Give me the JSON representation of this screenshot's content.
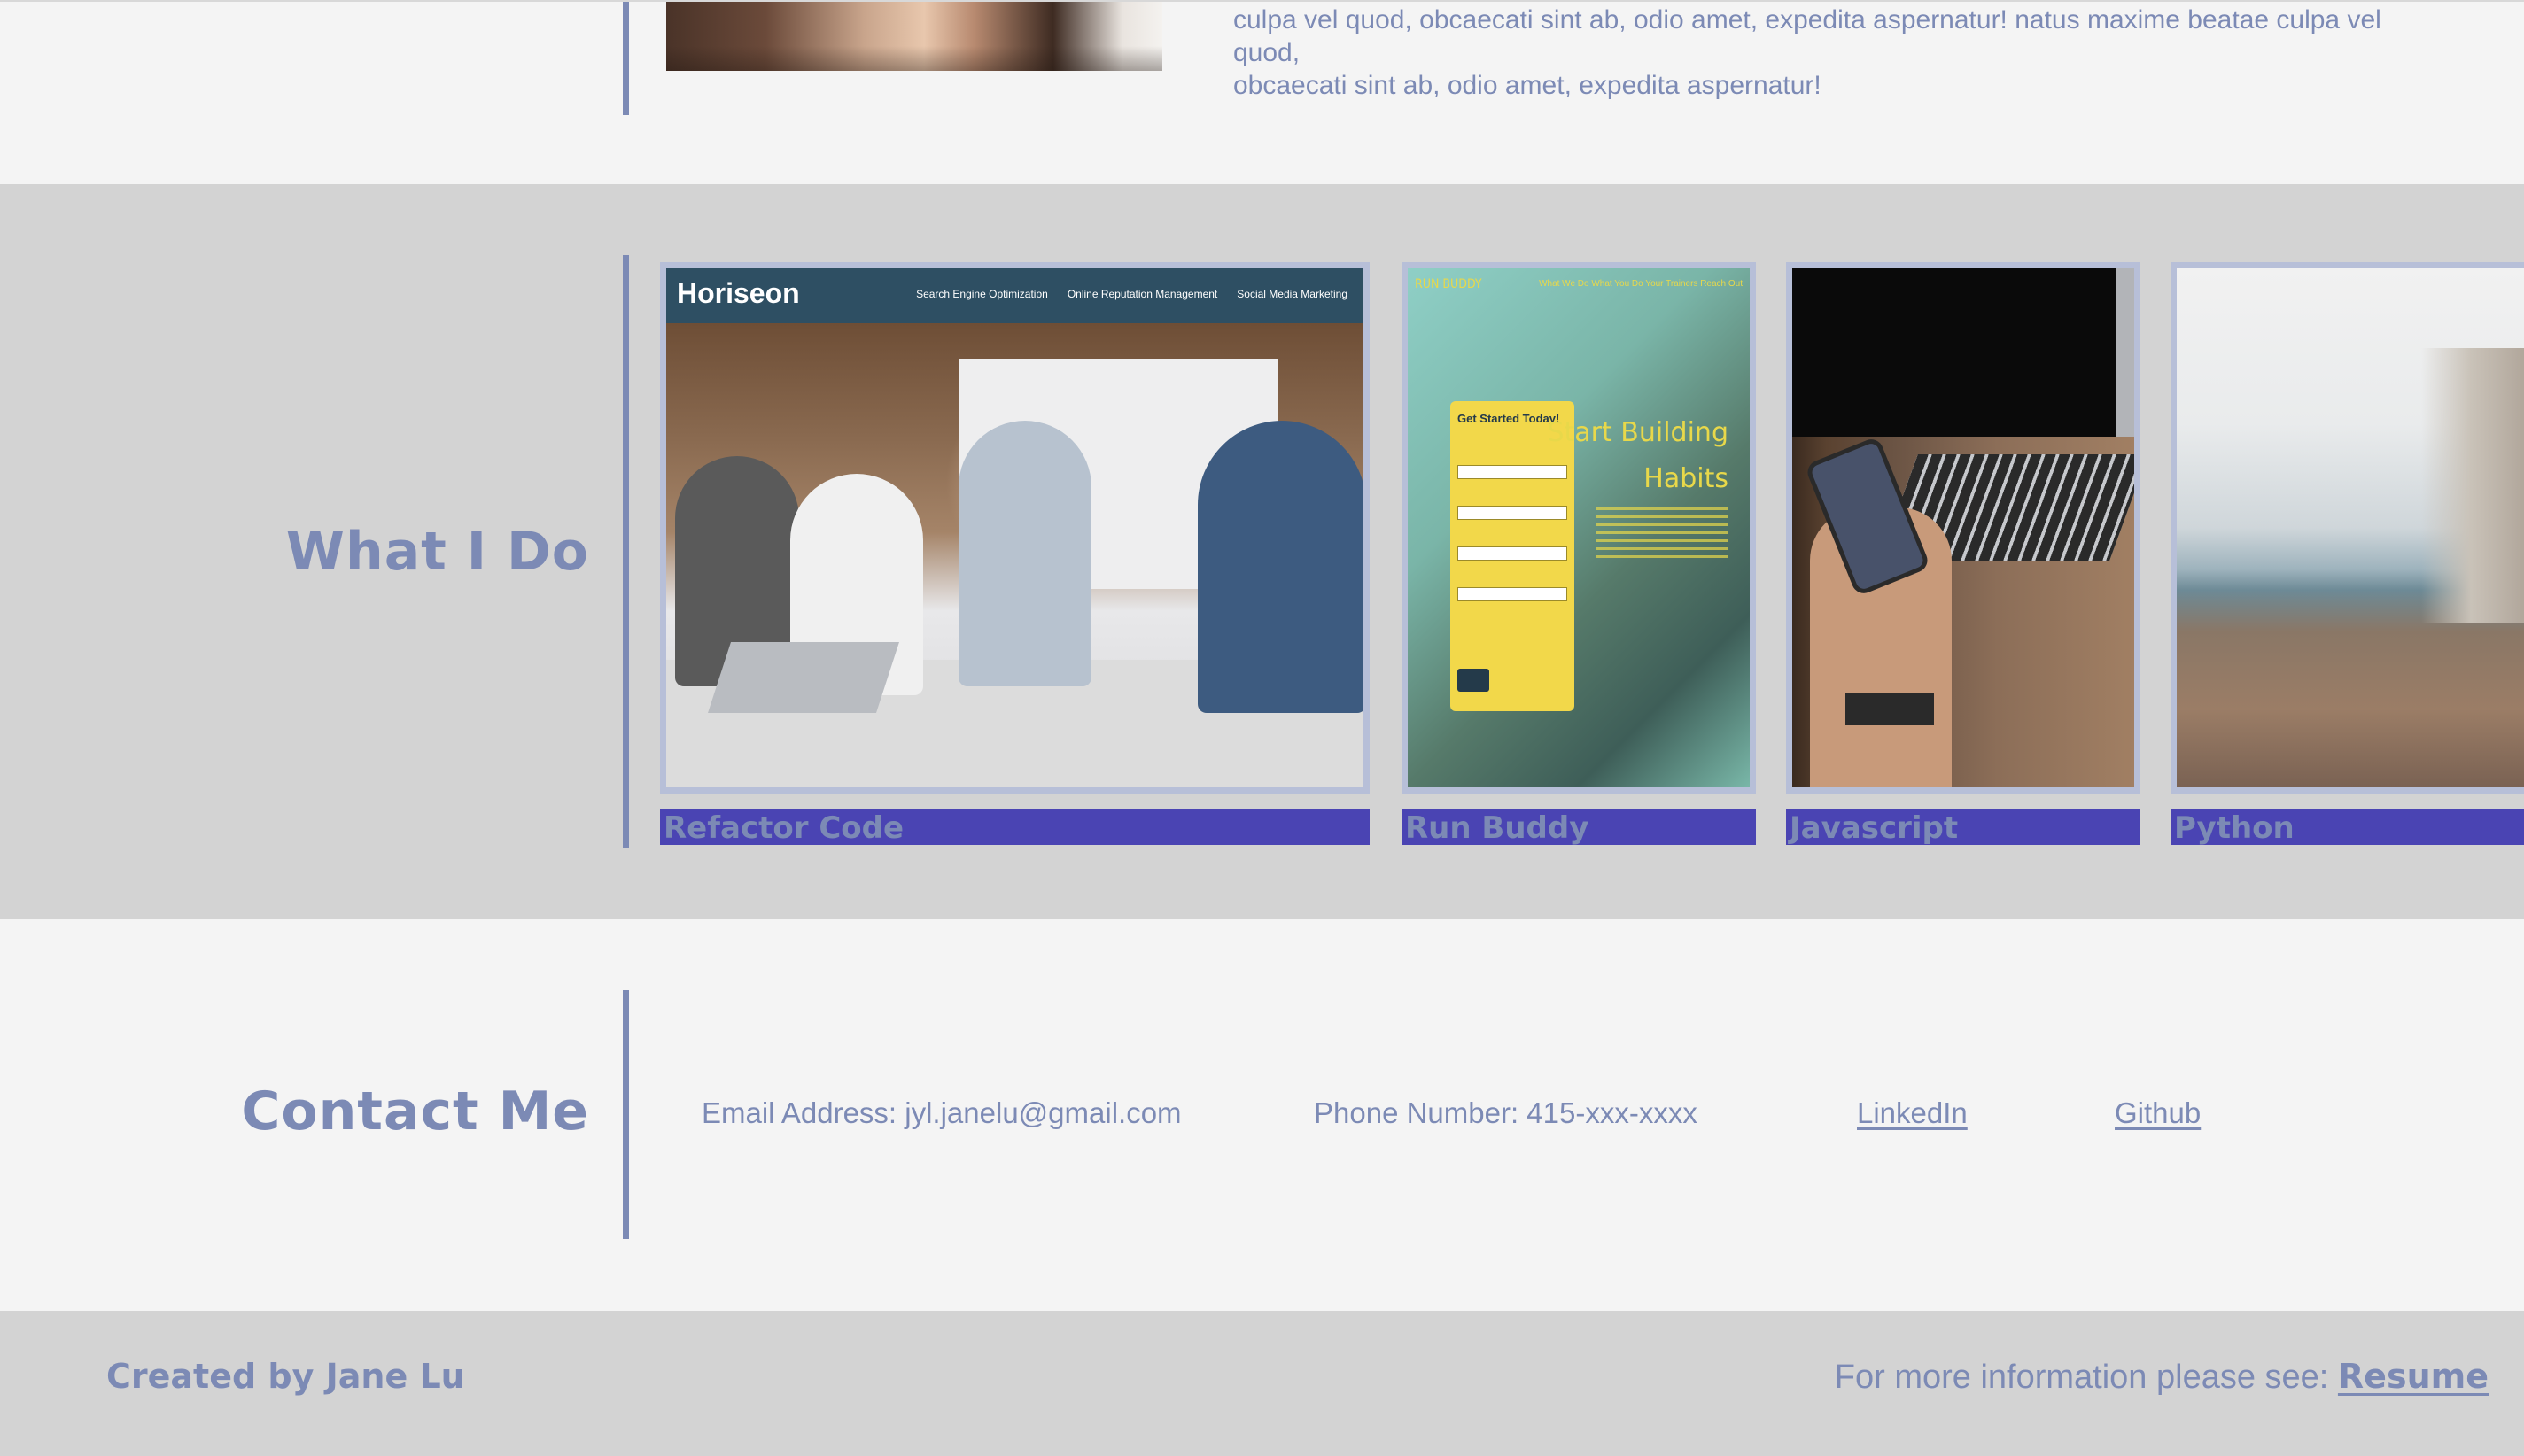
{
  "about": {
    "text_line1": "culpa vel quod, obcaecati sint ab, odio amet, expedita aspernatur! natus maxime beatae culpa vel quod,",
    "text_line2": "obcaecati sint ab, odio amet, expedita aspernatur!"
  },
  "work": {
    "title": "What I Do",
    "projects": [
      {
        "label": "Refactor Code",
        "screenshot": {
          "brand": "Horiseon",
          "nav": [
            "Search Engine Optimization",
            "Online Reputation Management",
            "Social Media Marketing"
          ]
        }
      },
      {
        "label": "Run Buddy",
        "screenshot": {
          "logo": "RUN BUDDY",
          "nav": "What We Do   What You Do   Your Trainers   Reach Out",
          "form_heading": "Get Started Today!",
          "headline_line1": "Start Building",
          "headline_line2": "Habits"
        }
      },
      {
        "label": "Javascript"
      },
      {
        "label": "Python"
      }
    ]
  },
  "contact": {
    "title": "Contact Me",
    "email": "Email Address: jyl.janelu@gmail.com",
    "phone": "Phone Number: 415-xxx-xxxx",
    "linkedin": "LinkedIn",
    "github": "Github"
  },
  "footer": {
    "created_by": "Created by Jane Lu",
    "more_info": "For more information please see: ",
    "resume": "Resume"
  },
  "colors": {
    "accent_text": "#7c8ab5",
    "label_bar": "#4a44b3",
    "section_gray": "#d3d3d3",
    "page_bg": "#f4f4f4",
    "card_border": "#b7bfd8"
  }
}
